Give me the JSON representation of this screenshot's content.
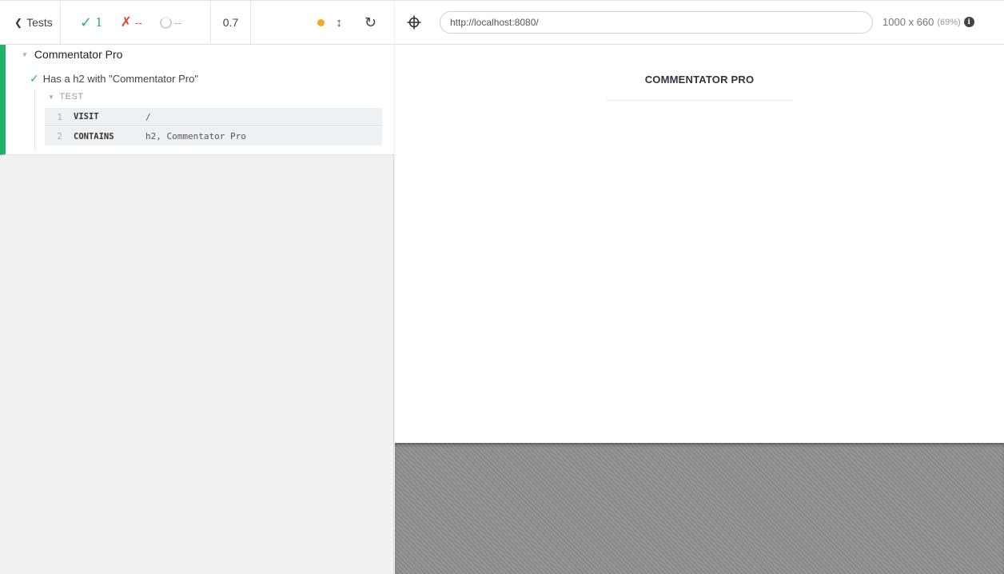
{
  "reporter": {
    "header": {
      "tests_label": "Tests",
      "passed_count": "1",
      "failed_count": "--",
      "pending_count": "--",
      "duration": "0.7"
    },
    "suite": {
      "title": "Commentator Pro",
      "test": {
        "title": "Has a h2 with \"Commentator Pro\"",
        "section_label": "TEST",
        "commands": [
          {
            "number": "1",
            "name": "VISIT",
            "message": "/"
          },
          {
            "number": "2",
            "name": "CONTAINS",
            "message": "h2, Commentator Pro"
          }
        ]
      }
    }
  },
  "aut": {
    "url": "http://localhost:8080/",
    "viewport": "1000 x 660",
    "scale": "(69%)",
    "page": {
      "heading": "COMMENTATOR PRO"
    }
  },
  "colors": {
    "pass": "#2ab261",
    "fail": "#e34234",
    "running_dot": "#f5a623",
    "suite_bar": "#1fb36b"
  }
}
